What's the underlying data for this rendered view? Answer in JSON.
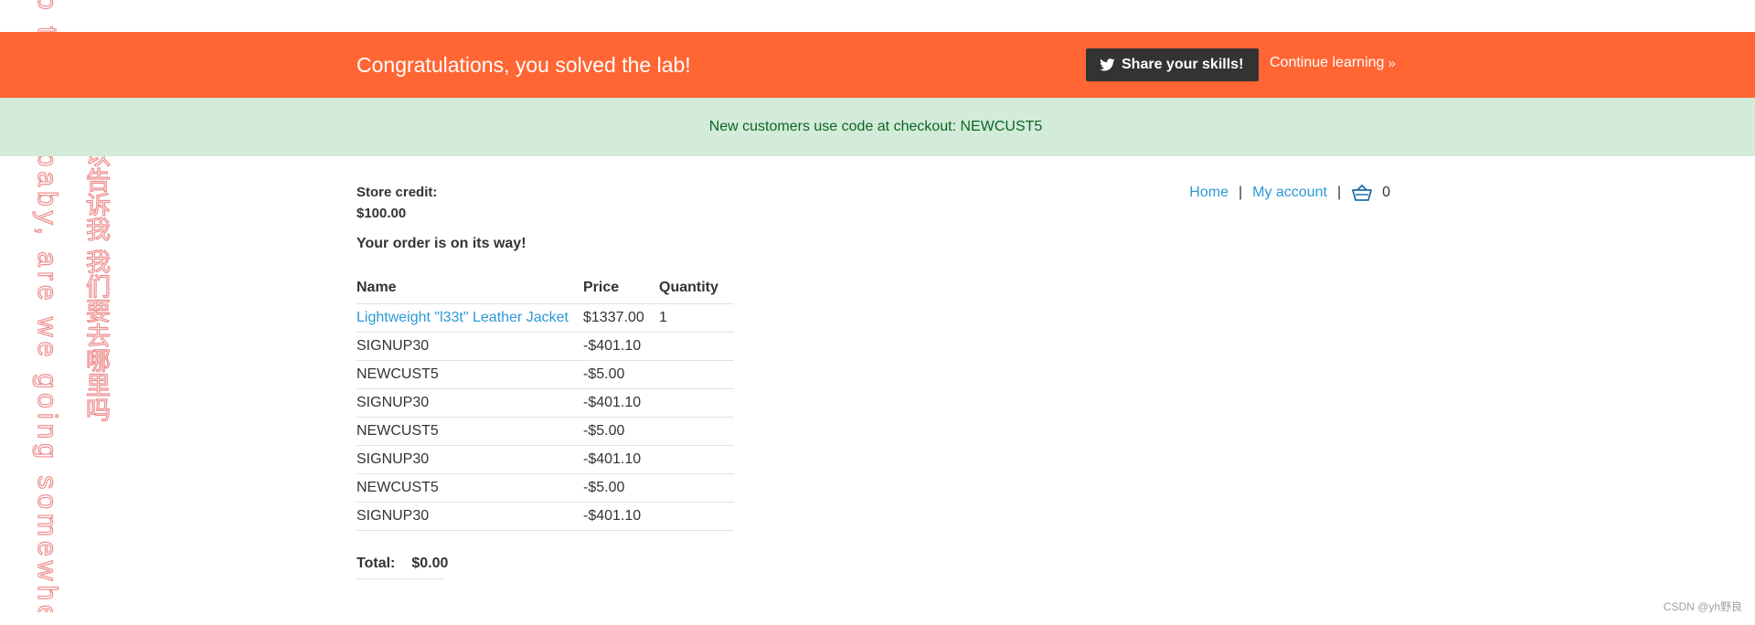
{
  "lab_banner": {
    "title": "Congratulations, you solved the lab!",
    "share_label": "Share your skills!",
    "continue_label": "Continue learning",
    "continue_chevron": "»"
  },
  "notice": {
    "text": "New customers use code at checkout: NEWCUST5"
  },
  "nav": {
    "home": "Home",
    "separator": "|",
    "account": "My account",
    "cart_count": "0",
    "cart_icon": "basket-icon"
  },
  "store_credit": {
    "label": "Store credit:",
    "value": "$100.00"
  },
  "order_message": "Your order is on its way!",
  "table": {
    "headers": [
      "Name",
      "Price",
      "Quantity"
    ],
    "rows": [
      {
        "name": "Lightweight \"l33t\" Leather Jacket",
        "price": "$1337.00",
        "quantity": "1",
        "link": true
      },
      {
        "name": "SIGNUP30",
        "price": "-$401.10",
        "quantity": ""
      },
      {
        "name": "NEWCUST5",
        "price": "-$5.00",
        "quantity": ""
      },
      {
        "name": "SIGNUP30",
        "price": "-$401.10",
        "quantity": ""
      },
      {
        "name": "NEWCUST5",
        "price": "-$5.00",
        "quantity": ""
      },
      {
        "name": "SIGNUP30",
        "price": "-$401.10",
        "quantity": ""
      },
      {
        "name": "NEWCUST5",
        "price": "-$5.00",
        "quantity": ""
      },
      {
        "name": "SIGNUP30",
        "price": "-$401.10",
        "quantity": ""
      }
    ]
  },
  "total": {
    "label": "Total:",
    "value": "$0.00"
  },
  "decor": {
    "vertical_en": "o tell me baby, are we going somewhe",
    "vertical_cn": "所以告诉我 我们要去哪里吗"
  },
  "watermark": "CSDN @yh野良",
  "colors": {
    "banner": "#ff6633",
    "notice_bg": "#d3ebd9",
    "notice_text": "#0b6623",
    "link": "#2b99d6",
    "share_bg": "#333333",
    "decor_stroke": "#ee8e8e"
  }
}
